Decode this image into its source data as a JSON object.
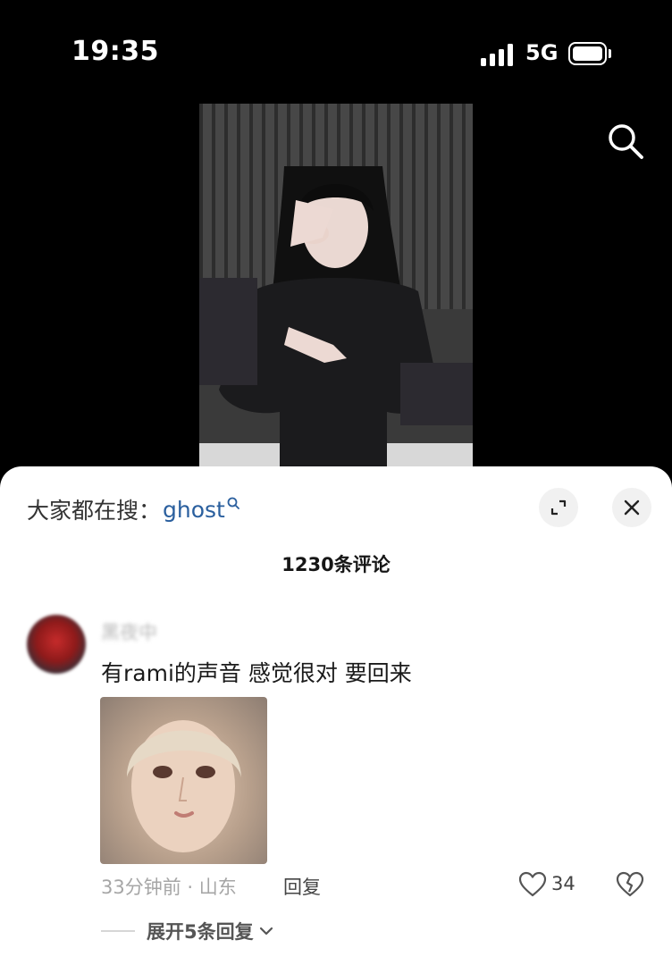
{
  "status_bar": {
    "time": "19:35",
    "network": "5G"
  },
  "trending": {
    "prefix": "大家都在搜：",
    "term": "ghost"
  },
  "comments_header": {
    "count_label": "1230条评论"
  },
  "comment": {
    "username": "黑夜中",
    "text": "有rami的声音 感觉很对 要回来",
    "time_location": "33分钟前 · 山东",
    "reply_label": "回复",
    "like_count": "34"
  },
  "expand_replies": {
    "label": "展开5条回复"
  },
  "colors": {
    "link": "#2a5f9e",
    "sheet_bg": "#ffffff",
    "page_bg": "#000000"
  }
}
